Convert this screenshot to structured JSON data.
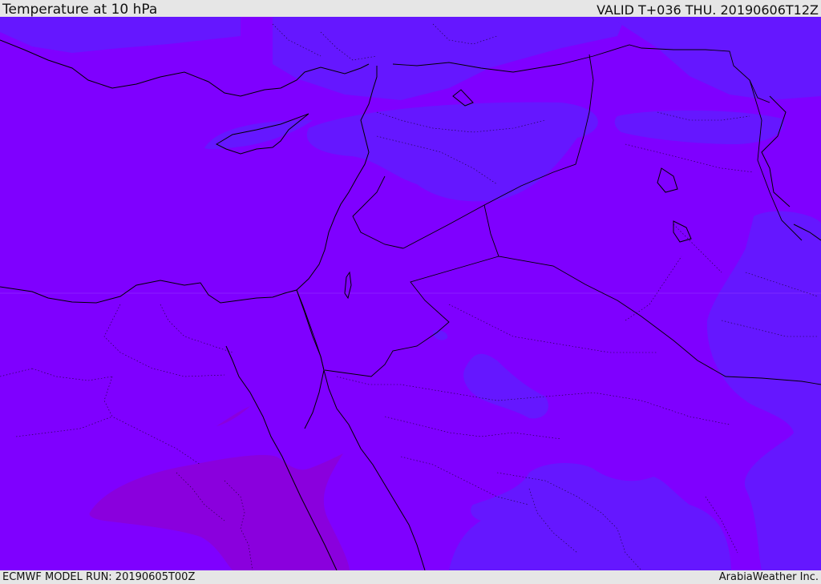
{
  "header": {
    "title": "Temperature at 10 hPa",
    "valid_time": "VALID T+036 THU. 20190606T12Z"
  },
  "footer": {
    "model_run": "ECMWF MODEL RUN: 20190605T00Z",
    "brand": "ArabiaWeather Inc."
  },
  "colors": {
    "base_field": "#7f00ff",
    "cooler_field": "#6517ff",
    "warmer_field": "#8a00dd",
    "header_bg": "#e6e6e6",
    "coastline": "#000000"
  }
}
